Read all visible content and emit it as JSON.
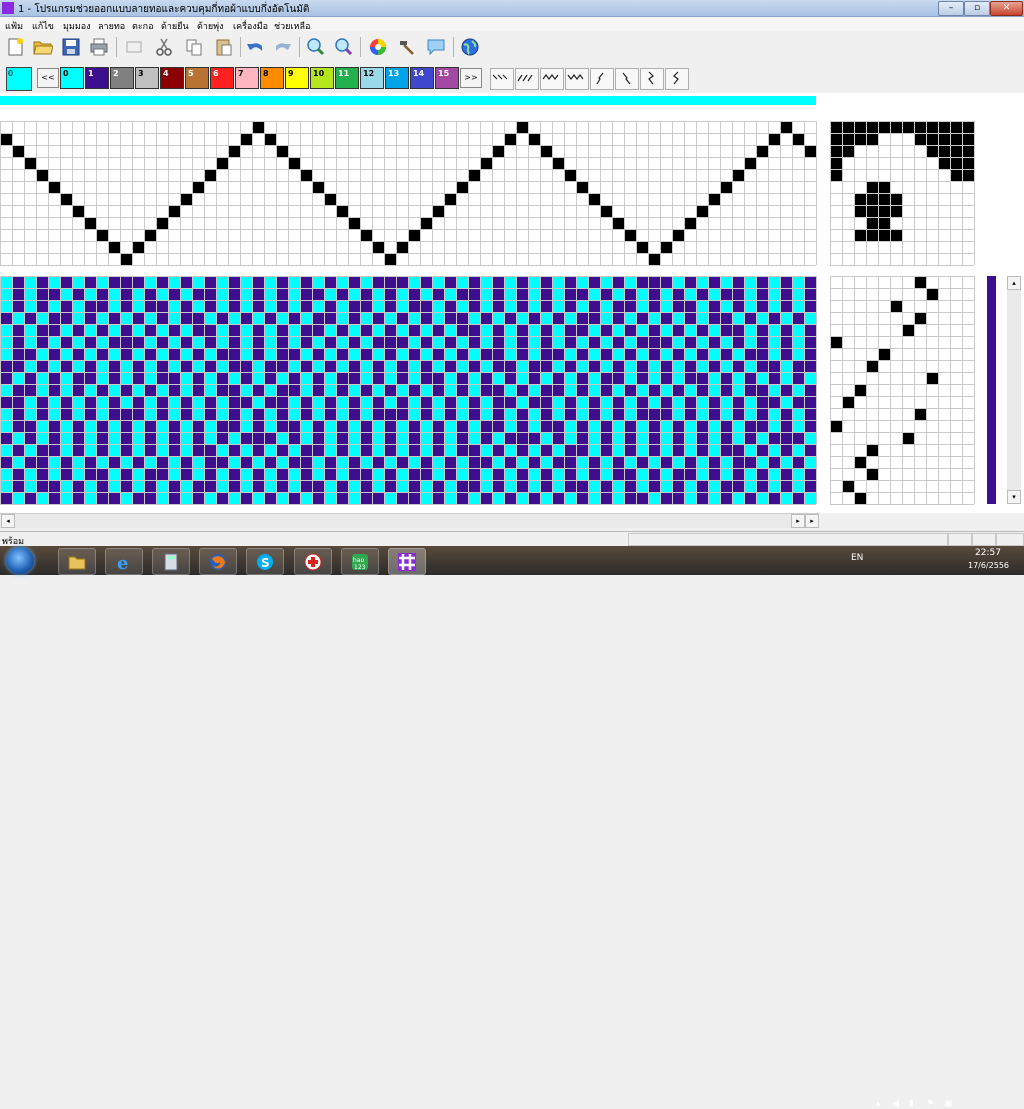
{
  "window": {
    "title": "1 - โปรแกรมช่วยออกแบบลายทอและควบคุมกี่ทอผ้าแบบกึ่งอัตโนมัติ",
    "min": "–",
    "max": "▫",
    "close": "✕"
  },
  "menu": [
    "แฟ้ม",
    "แก้ไข",
    "มุมมอง",
    "ลายทอ",
    "ตะกอ",
    "ด้ายยืน",
    "ด้ายพุ่ง",
    "เครื่องมือ",
    "ช่วยเหลือ"
  ],
  "palette": {
    "current_label": "0",
    "prev": "<<",
    "next": ">>",
    "colors": [
      {
        "label": "0",
        "hex": "#00ffff"
      },
      {
        "label": "1",
        "hex": "#3d0f8f"
      },
      {
        "label": "2",
        "hex": "#808080"
      },
      {
        "label": "3",
        "hex": "#c0c0c0"
      },
      {
        "label": "4",
        "hex": "#8b0000"
      },
      {
        "label": "5",
        "hex": "#b87333"
      },
      {
        "label": "6",
        "hex": "#ff2020"
      },
      {
        "label": "7",
        "hex": "#ffb6c1"
      },
      {
        "label": "8",
        "hex": "#ff8c00"
      },
      {
        "label": "9",
        "hex": "#ffff00"
      },
      {
        "label": "10",
        "hex": "#b5e61d"
      },
      {
        "label": "11",
        "hex": "#22b14c"
      },
      {
        "label": "12",
        "hex": "#99d9ea"
      },
      {
        "label": "13",
        "hex": "#00a2e8"
      },
      {
        "label": "14",
        "hex": "#3f48cc"
      },
      {
        "label": "15",
        "hex": "#a349a4"
      }
    ]
  },
  "colors": {
    "warp": "#00ffff",
    "weft": "#3d0f8f",
    "cell_on": "#000000",
    "grid": "#c9c9c9"
  },
  "statusbar": {
    "text": "พร้อม"
  },
  "taskbar": {
    "lang": "EN",
    "time": "22:57",
    "date": "17/6/2556",
    "hao_label": "hao\n123"
  }
}
